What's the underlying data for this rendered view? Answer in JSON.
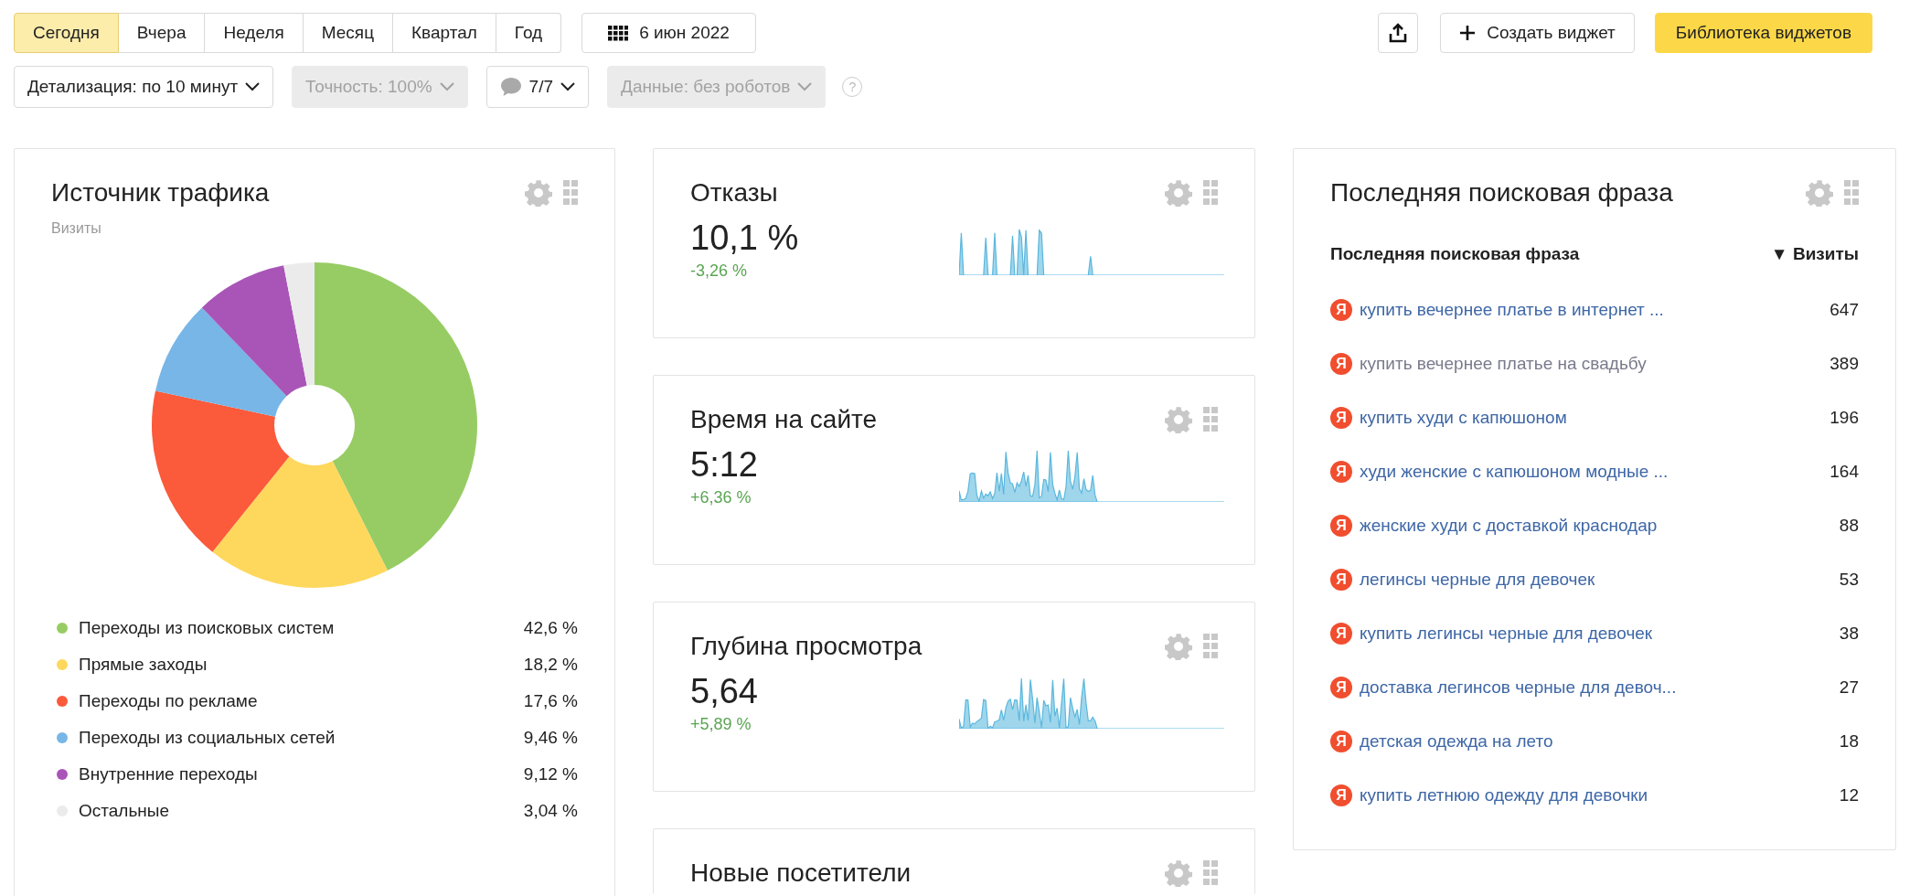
{
  "period_tabs": [
    {
      "label": "Сегодня",
      "selected": true
    },
    {
      "label": "Вчера",
      "selected": false
    },
    {
      "label": "Неделя",
      "selected": false
    },
    {
      "label": "Месяц",
      "selected": false
    },
    {
      "label": "Квартал",
      "selected": false
    },
    {
      "label": "Год",
      "selected": false
    }
  ],
  "date_button": {
    "label": "6 июн 2022"
  },
  "actions": {
    "create_widget": "Создать виджет",
    "widget_library": "Библиотека виджетов"
  },
  "filters": [
    {
      "kind": "dropdown",
      "label": "Детализация: по 10 минут",
      "disabled": false
    },
    {
      "kind": "dropdown",
      "label": "Точность: 100%",
      "disabled": true
    },
    {
      "kind": "segments",
      "label": "7/7",
      "disabled": false
    },
    {
      "kind": "dropdown",
      "label": "Данные: без роботов",
      "disabled": true
    }
  ],
  "help": "?",
  "traffic_widget": {
    "title": "Источник трафика",
    "subtitle": "Визиты",
    "chart_data": {
      "type": "donut",
      "categories": [
        "Переходы из поисковых систем",
        "Прямые заходы",
        "Переходы по рекламе",
        "Переходы из социальных сетей",
        "Внутренние переходы",
        "Остальные"
      ],
      "values": [
        42.6,
        18.2,
        17.6,
        9.46,
        9.12,
        3.04
      ]
    },
    "legend": [
      {
        "value": "42,6 %",
        "color": "#97cc64"
      },
      {
        "value": "18,2 %",
        "color": "#fed85d"
      },
      {
        "value": "17,6 %",
        "color": "#fb5a3b"
      },
      {
        "value": "9,46 %",
        "color": "#77b6e7"
      },
      {
        "value": "9,12 %",
        "color": "#a955b8"
      },
      {
        "value": "3,04 %",
        "color": "#ebebeb"
      }
    ]
  },
  "metric_widgets": [
    {
      "title": "Отказы",
      "value": "10,1 %",
      "change": "-3,26 %",
      "favorable": true
    },
    {
      "title": "Время на сайте",
      "value": "5:12",
      "change": "+6,36 %",
      "favorable": true
    },
    {
      "title": "Глубина просмотра",
      "value": "5,64",
      "change": "+5,89 %",
      "favorable": true
    },
    {
      "title": "Новые посетители"
    }
  ],
  "search_widget": {
    "title": "Последняя поисковая фраза",
    "columns": [
      "Последняя поисковая фраза",
      "Визиты"
    ],
    "sort_mark": "▼",
    "rows": [
      {
        "mark": "Я",
        "phrase": "купить вечернее платье в интернет ...",
        "visits": "647",
        "visited": false
      },
      {
        "mark": "Я",
        "phrase": "купить вечернее платье на свадьбу",
        "visits": "389",
        "visited": true
      },
      {
        "mark": "Я",
        "phrase": "купить худи с капюшоном",
        "visits": "196",
        "visited": false
      },
      {
        "mark": "Я",
        "phrase": "худи женские с капюшоном модные ...",
        "visits": "164",
        "visited": false
      },
      {
        "mark": "Я",
        "phrase": "женские худи с доставкой краснодар",
        "visits": "88",
        "visited": false
      },
      {
        "mark": "Я",
        "phrase": "легинсы черные для девочек",
        "visits": "53",
        "visited": false
      },
      {
        "mark": "Я",
        "phrase": "купить легинсы черные для девочек",
        "visits": "38",
        "visited": false
      },
      {
        "mark": "Я",
        "phrase": "доставка легинсов черные для девоч...",
        "visits": "27",
        "visited": false
      },
      {
        "mark": "Я",
        "phrase": "детская одежда на лето",
        "visits": "18",
        "visited": false
      },
      {
        "mark": "Я",
        "phrase": "купить летнюю одежду для девочки",
        "visits": "12",
        "visited": false
      }
    ]
  }
}
